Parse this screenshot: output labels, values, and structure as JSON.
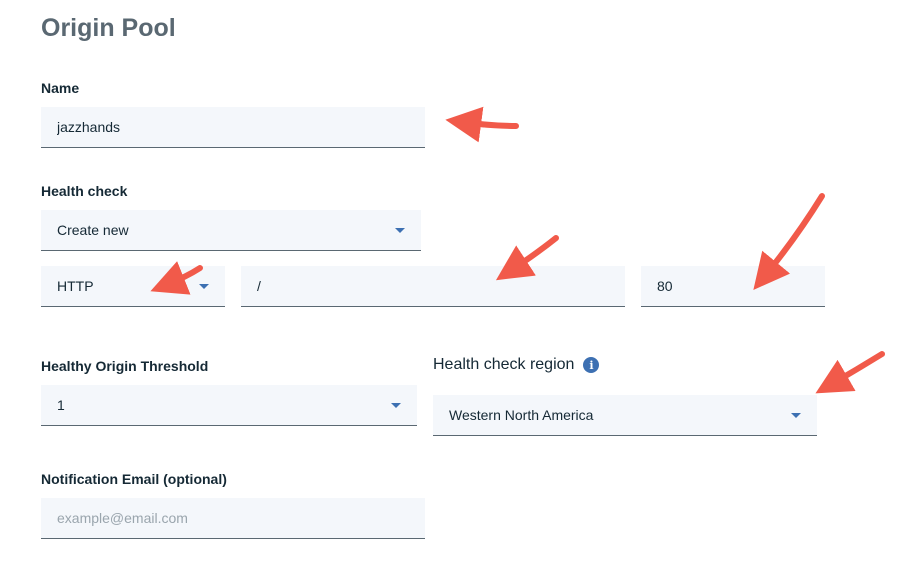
{
  "page": {
    "title": "Origin Pool"
  },
  "name": {
    "label": "Name",
    "value": "jazzhands"
  },
  "health_check": {
    "label": "Health check",
    "type_select": "Create new",
    "protocol_select": "HTTP",
    "path_value": "/",
    "port_value": "80"
  },
  "threshold": {
    "label": "Healthy Origin Threshold",
    "value": "1"
  },
  "region": {
    "label": "Health check region",
    "info_glyph": "i",
    "value": "Western North America"
  },
  "email": {
    "label": "Notification Email (optional)",
    "placeholder": "example@email.com",
    "value": ""
  },
  "colors": {
    "accent": "#3d70b2",
    "field_bg": "#f4f7fb",
    "annotation_arrow": "#f15a4a"
  }
}
